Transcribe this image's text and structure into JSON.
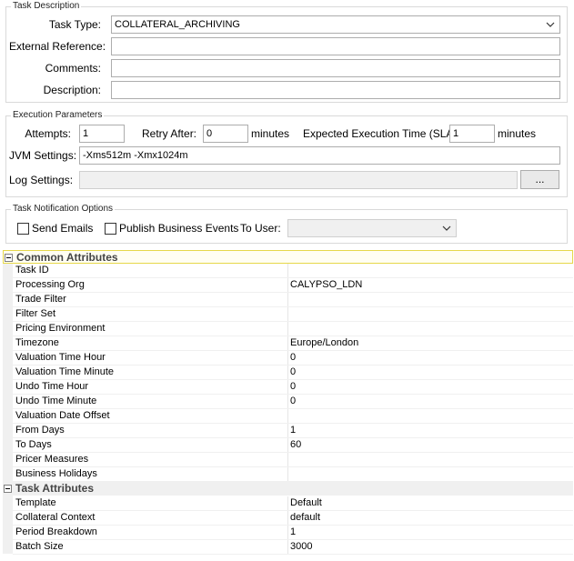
{
  "task_description": {
    "legend": "Task Description",
    "task_type_label": "Task Type:",
    "task_type_value": "COLLATERAL_ARCHIVING",
    "external_reference_label": "External Reference:",
    "external_reference_value": "",
    "comments_label": "Comments:",
    "comments_value": "",
    "description_label": "Description:",
    "description_value": ""
  },
  "execution_parameters": {
    "legend": "Execution Parameters",
    "attempts_label": "Attempts:",
    "attempts_value": "1",
    "retry_after_label": "Retry After:",
    "retry_after_value": "0",
    "retry_unit": "minutes",
    "sla_label": "Expected Execution Time (SLA):",
    "sla_value": "1",
    "sla_unit": "minutes",
    "jvm_label": "JVM Settings:",
    "jvm_value": "-Xms512m -Xmx1024m",
    "log_label": "Log Settings:",
    "log_value": "",
    "log_button": "..."
  },
  "task_notification": {
    "legend": "Task Notification Options",
    "send_emails_label": "Send Emails",
    "send_emails_checked": false,
    "publish_label": "Publish Business Events",
    "publish_checked": false,
    "to_user_label": "To User:",
    "to_user_value": ""
  },
  "attributes": {
    "common": {
      "title": "Common Attributes",
      "rows": [
        {
          "key": "Task ID",
          "value": ""
        },
        {
          "key": "Processing Org",
          "value": "CALYPSO_LDN"
        },
        {
          "key": "Trade Filter",
          "value": ""
        },
        {
          "key": "Filter Set",
          "value": ""
        },
        {
          "key": "Pricing Environment",
          "value": ""
        },
        {
          "key": "Timezone",
          "value": "Europe/London"
        },
        {
          "key": "Valuation Time Hour",
          "value": "0"
        },
        {
          "key": "Valuation Time Minute",
          "value": "0"
        },
        {
          "key": "Undo Time Hour",
          "value": "0"
        },
        {
          "key": "Undo Time Minute",
          "value": "0"
        },
        {
          "key": "Valuation Date Offset",
          "value": ""
        },
        {
          "key": "From Days",
          "value": "1"
        },
        {
          "key": "To Days",
          "value": "60"
        },
        {
          "key": "Pricer Measures",
          "value": ""
        },
        {
          "key": "Business Holidays",
          "value": ""
        }
      ]
    },
    "task": {
      "title": "Task Attributes",
      "rows": [
        {
          "key": "Template",
          "value": "Default"
        },
        {
          "key": "Collateral Context",
          "value": "default"
        },
        {
          "key": "Period Breakdown",
          "value": "1"
        },
        {
          "key": "Batch Size",
          "value": "3000"
        }
      ]
    }
  }
}
